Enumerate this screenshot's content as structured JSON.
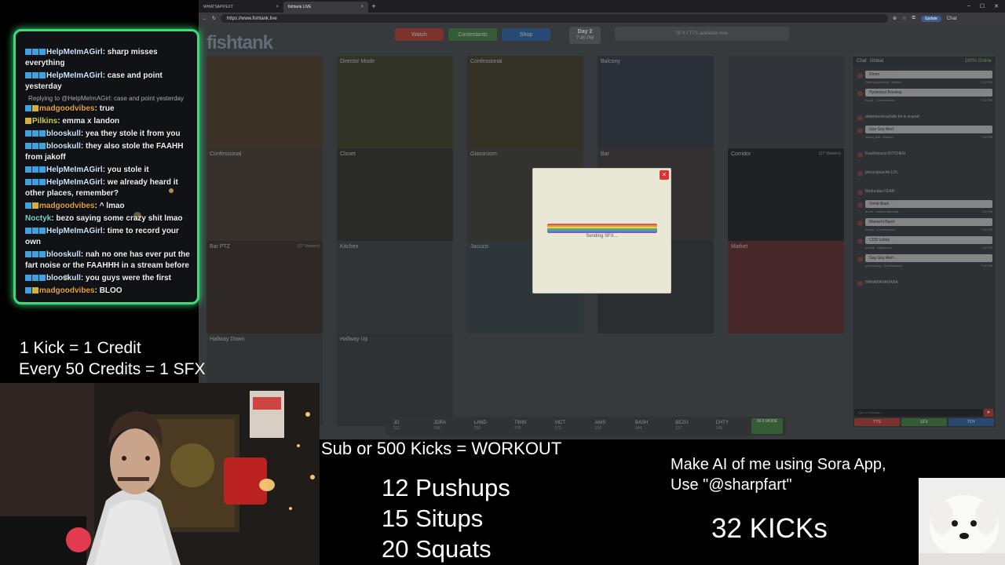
{
  "browser": {
    "tabs": [
      {
        "label": "WHATSAPP.EXT"
      },
      {
        "label": "fishtank LIVE"
      }
    ],
    "url": "https://www.fishtank.live",
    "update_label": "Update",
    "profile_label": "Chat"
  },
  "site": {
    "logo": "fishtank",
    "nav": [
      {
        "label": "Watch",
        "color": "#b94a44"
      },
      {
        "label": "Contestants",
        "color": "#4f8a4f"
      },
      {
        "label": "Shop",
        "color": "#3c6ea8"
      }
    ],
    "day_label": "Day 2",
    "day_time": "7:45 PM",
    "sfx_placeholder": "SFX / TTS available now"
  },
  "cameras": [
    {
      "label": "",
      "viewers": ""
    },
    {
      "label": "Director Mode",
      "viewers": ""
    },
    {
      "label": "Confessional",
      "viewers": ""
    },
    {
      "label": "Balcony",
      "viewers": ""
    },
    {
      "label": "",
      "viewers": ""
    },
    {
      "label": "Confessional",
      "viewers": ""
    },
    {
      "label": "Closet",
      "viewers": ""
    },
    {
      "label": "Glassroom",
      "viewers": ""
    },
    {
      "label": "Bar",
      "viewers": ""
    },
    {
      "label": "Corridor",
      "viewers": "(27 Viewers)"
    },
    {
      "label": "Bar PTZ",
      "viewers": "(37 Viewers)"
    },
    {
      "label": "Kitchen",
      "viewers": ""
    },
    {
      "label": "Jacuzzi",
      "viewers": ""
    },
    {
      "label": "",
      "viewers": ""
    },
    {
      "label": "Market",
      "viewers": ""
    },
    {
      "label": "Hallway Down",
      "viewers": ""
    },
    {
      "label": "Hallway Up",
      "viewers": ""
    }
  ],
  "contestants": [
    {
      "name": "JD",
      "credits": "122"
    },
    {
      "name": "JDRA",
      "credits": "158"
    },
    {
      "name": "LAND",
      "credits": "250"
    },
    {
      "name": "TWIN",
      "credits": "279"
    },
    {
      "name": "VICT",
      "credits": "172"
    },
    {
      "name": "ANIS",
      "credits": "150"
    },
    {
      "name": "BASH",
      "credits": "144"
    },
    {
      "name": "BEZO",
      "credits": "117"
    },
    {
      "name": "CHTY",
      "credits": "145"
    }
  ],
  "sfx_button": "SFX MODE",
  "site_chat": {
    "title": "Chat",
    "subtitle": "Global",
    "online": "100% Online",
    "messages": [
      {
        "bubble": "Doom",
        "user": "DarkSympathetic",
        "room": "Market",
        "time": "7:42 PM"
      },
      {
        "bubble": "Hysterical Breakup",
        "user": "boyo1",
        "room": "Confessional",
        "time": "7:42 PM"
      },
      {
        "plain": "dobemaximushdix he is scared"
      },
      {
        "bubble": "Gay Guy Alert",
        "user": "shaun_fish",
        "room": "Kitchen",
        "time": "7:42 PM"
      },
      {
        "plain": "FoulVolcano KITCHEN"
      },
      {
        "plain": "prnccspeachh LOL"
      },
      {
        "plain": "Redundas FEAR"
      },
      {
        "bubble": "Vomit Blast",
        "user": "de-art",
        "room": "Market Alternate",
        "time": "7:42 PM"
      },
      {
        "bubble": "Mariachi Band",
        "user": "daruth",
        "room": "Confessional",
        "time": "7:42 PM"
      },
      {
        "bubble": "COD Lobby",
        "user": "pdndlk",
        "room": "Glassroom",
        "time": "7:42 PM"
      },
      {
        "bubble": "Gay Guy Alert",
        "user": "pinchybong",
        "room": "Confessional",
        "time": "7:42 PM"
      },
      {
        "plain": "HAHAHAHAHAHA"
      }
    ],
    "input_placeholder": "Type a message...",
    "send_label": "➤",
    "buttons": [
      {
        "label": "TTS",
        "color": "#b94a44"
      },
      {
        "label": "SFX",
        "color": "#4f8a4f"
      },
      {
        "label": "TOY",
        "color": "#3c6ea8"
      }
    ]
  },
  "modal": {
    "close": "×",
    "status": "Sending SFX..."
  },
  "stream_chat": [
    {
      "user": "HelpMeImAGirl",
      "text": "sharp misses everything",
      "badges": 3
    },
    {
      "user": "HelpMeImAGirl",
      "text": "case and point yesterday",
      "badges": 3
    },
    {
      "reply": "Replying to @HelpMeImAGirl: case and point yesterday"
    },
    {
      "user": "madgoodvibes",
      "text": "true",
      "badges": 2,
      "color": "#e8a33c"
    },
    {
      "user": "Pilkins",
      "text": "emma x landon",
      "badges": 1,
      "color": "#d4d43c"
    },
    {
      "user": "blooskull",
      "text": "yea they stole it from you",
      "badges": 3
    },
    {
      "user": "blooskull",
      "text": "they also stole the FAAHH from jakoff",
      "badges": 3
    },
    {
      "user": "HelpMeImAGirl",
      "text": "you stole it",
      "badges": 3
    },
    {
      "user": "HelpMeImAGirl",
      "text": "we already heard it other places, remember?",
      "badges": 3
    },
    {
      "user": "madgoodvibes",
      "text": "^ lmao",
      "badges": 2,
      "color": "#e8a33c"
    },
    {
      "user": "Noctyk",
      "text": "bezo saying some crazy shit lmao",
      "badges": 0,
      "color": "#7ad4d4"
    },
    {
      "user": "HelpMeImAGirl",
      "text": "time to record your own",
      "badges": 3
    },
    {
      "user": "blooskull",
      "text": "nah no one has ever put the fart noise or the FAAHHH in a stream before",
      "badges": 3
    },
    {
      "user": "blooskull",
      "text": "you guys were the first",
      "badges": 3
    },
    {
      "user": "madgoodvibes",
      "text": "BLOO",
      "badges": 2,
      "color": "#e8a33c"
    }
  ],
  "overlay": {
    "kick_line": "1 Kick = 1 Credit",
    "credits_line": "Every 50 Credits  = 1 SFX",
    "workout_title": "Sub or 500 Kicks = WORKOUT",
    "workout": [
      "12 Pushups",
      "15 Situps",
      "20 Squats"
    ],
    "sora_line1": "Make AI of me using Sora App,",
    "sora_line2": "Use \"@sharpfart\"",
    "kicks_count": "32 KICKs"
  },
  "colors": {
    "chat_border": "#3adc7a",
    "accent_red": "#d33"
  }
}
